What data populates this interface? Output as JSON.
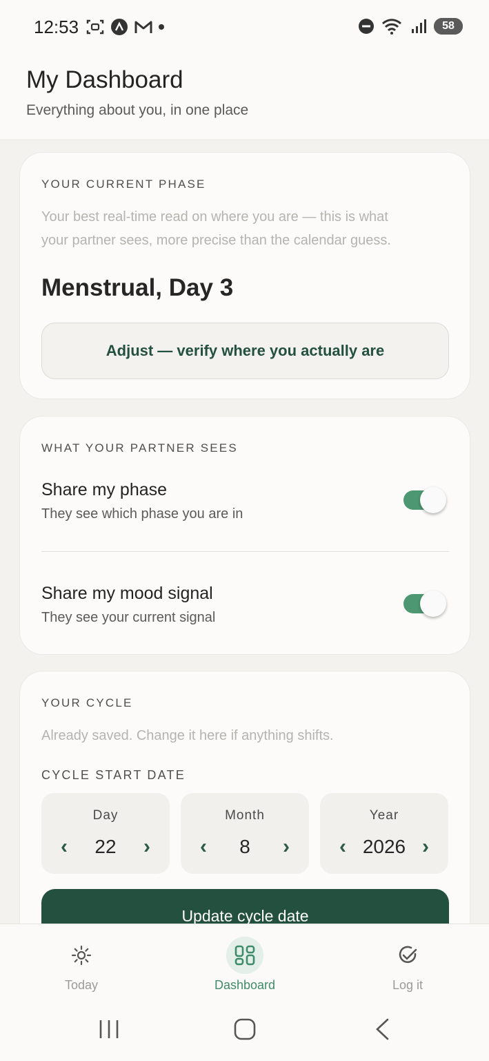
{
  "status_bar": {
    "time": "12:53",
    "battery": "58",
    "icons_left": [
      "screenshot-icon",
      "app-a-icon",
      "gmail-icon",
      "notification-dot"
    ],
    "icons_right": [
      "do-not-disturb-icon",
      "wifi-icon",
      "signal-icon",
      "battery-icon"
    ]
  },
  "header": {
    "title": "My Dashboard",
    "subtitle": "Everything about you, in one place"
  },
  "phase_card": {
    "eyebrow": "YOUR CURRENT PHASE",
    "description_line1": "Your best real-time read on where you are — this is what",
    "description_line2": "your partner sees, more precise than the calendar guess.",
    "phase": "Menstrual, Day 3",
    "adjust_label": "Adjust — verify where you actually are"
  },
  "partner_card": {
    "eyebrow": "WHAT YOUR PARTNER SEES",
    "items": [
      {
        "title": "Share my phase",
        "subtitle": "They see which phase you are in",
        "enabled": true
      },
      {
        "title": "Share my mood signal",
        "subtitle": "They see your current signal",
        "enabled": true
      }
    ]
  },
  "cycle_card": {
    "eyebrow": "YOUR CYCLE",
    "description": "Already saved. Change it here if anything shifts.",
    "start_label": "CYCLE START DATE",
    "pickers": [
      {
        "label": "Day",
        "value": "22"
      },
      {
        "label": "Month",
        "value": "8"
      },
      {
        "label": "Year",
        "value": "2026"
      }
    ],
    "prev_glyph": "‹",
    "next_glyph": "›",
    "update_label": "Update cycle date"
  },
  "bottom_nav": {
    "items": [
      {
        "label": "Today",
        "icon": "sun-icon",
        "active": false
      },
      {
        "label": "Dashboard",
        "icon": "grid-icon",
        "active": true
      },
      {
        "label": "Log it",
        "icon": "check-circle-icon",
        "active": false
      }
    ]
  },
  "colors": {
    "accent": "#23503f",
    "toggle_on": "#4d9873",
    "background": "#f3f2ee",
    "card": "#fcfbfa"
  }
}
